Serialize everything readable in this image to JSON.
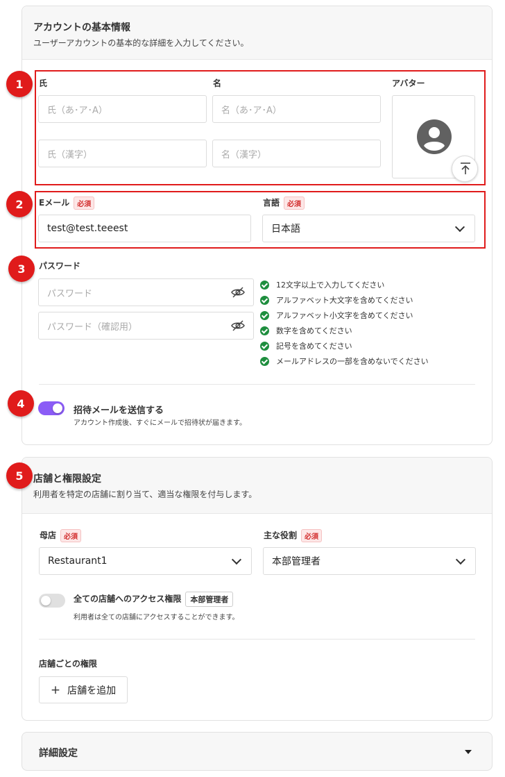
{
  "basic_info": {
    "title": "アカウントの基本情報",
    "description": "ユーザーアカウントの基本的な詳細を入力してください。"
  },
  "name": {
    "last_label": "氏",
    "first_label": "名",
    "last_kana_placeholder": "氏（あ･ア･A）",
    "first_kana_placeholder": "名（あ･ア･A）",
    "last_kanji_placeholder": "氏（漢字）",
    "first_kanji_placeholder": "名（漢字）",
    "avatar_label": "アバター"
  },
  "email": {
    "label": "Eメール",
    "required": "必須",
    "value": "test@test.teeest"
  },
  "language": {
    "label": "言語",
    "required": "必須",
    "value": "日本語"
  },
  "password": {
    "label": "パスワード",
    "placeholder": "パスワード",
    "confirm_placeholder": "パスワード（確認用）",
    "rules": [
      "12文字以上で入力してください",
      "アルファベット大文字を含めてください",
      "アルファベット小文字を含めてください",
      "数字を含めてください",
      "記号を含めてください",
      "メールアドレスの一部を含めないでください"
    ]
  },
  "invite": {
    "label": "招待メールを送信する",
    "description": "アカウント作成後、すぐにメールで招待状が届きます。",
    "enabled": true
  },
  "store": {
    "title": "店舗と権限設定",
    "description": "利用者を特定の店舗に割り当て、適当な権限を付与します。",
    "parent_label": "母店",
    "parent_required": "必須",
    "parent_value": "Restaurant1",
    "role_label": "主な役割",
    "role_required": "必須",
    "role_value": "本部管理者",
    "all_access_label": "全ての店舗へのアクセス権限",
    "all_access_tag": "本部管理者",
    "all_access_description": "利用者は全ての店舗にアクセスすることができます。",
    "all_access_enabled": false,
    "per_store_label": "店舗ごとの権限",
    "add_store_label": "店舗を追加"
  },
  "advanced": {
    "title": "詳細設定"
  },
  "markers": [
    "1",
    "2",
    "3",
    "4",
    "5"
  ],
  "colors": {
    "accent": "#8b5cf6",
    "required_red": "#d32f2f",
    "annotation_red": "#e01b1b",
    "check_green": "#1e8e3e"
  }
}
